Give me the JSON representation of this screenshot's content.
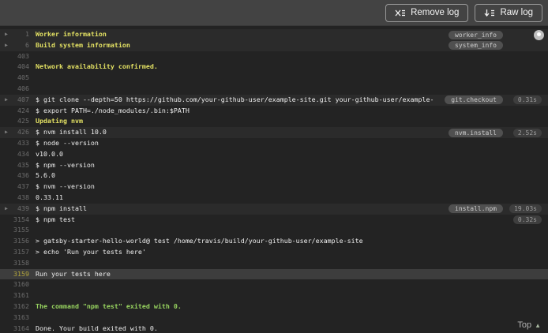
{
  "toolbar": {
    "remove_log_label": "Remove log",
    "raw_log_label": "Raw log"
  },
  "footer": {
    "top_label": "Top"
  },
  "colors": {
    "topbar_bg": "#434343",
    "log_bg": "#232323",
    "fold_row_bg": "#2b2b2b",
    "highlight_row_bg": "#3d3d3d",
    "ansi_yellow": "#e3e163",
    "ansi_green": "#97d35f",
    "log_text": "#efefef",
    "line_number": "#6d6d6d",
    "highlight_line_number": "#b3a53c"
  },
  "log": {
    "rows": [
      {
        "num": "1",
        "text": "Worker information",
        "style": "yellow",
        "fold": true,
        "fold_bg": true,
        "badge": "worker_info",
        "scroll_knob": true
      },
      {
        "num": "6",
        "text": "Build system information",
        "style": "yellow",
        "fold": true,
        "fold_bg": true,
        "badge": "system_info"
      },
      {
        "num": "403",
        "text": ""
      },
      {
        "num": "404",
        "text": "Network availability confirmed.",
        "style": "yellow"
      },
      {
        "num": "405",
        "text": ""
      },
      {
        "num": "406",
        "text": ""
      },
      {
        "num": "407",
        "text": "$ git clone --depth=50 https://github.com/your-github-user/example-site.git your-github-user/example-",
        "fold": true,
        "fold_bg": true,
        "badge": "git.checkout",
        "duration": "0.31s"
      },
      {
        "num": "424",
        "text": "$ export PATH=./node_modules/.bin:$PATH"
      },
      {
        "num": "425",
        "text": "Updating nvm",
        "style": "yellow"
      },
      {
        "num": "426",
        "text": "$ nvm install 10.0",
        "fold": true,
        "fold_bg": true,
        "badge": "nvm.install",
        "duration": "2.52s"
      },
      {
        "num": "433",
        "text": "$ node --version"
      },
      {
        "num": "434",
        "text": "v10.0.0"
      },
      {
        "num": "435",
        "text": "$ npm --version"
      },
      {
        "num": "436",
        "text": "5.6.0"
      },
      {
        "num": "437",
        "text": "$ nvm --version"
      },
      {
        "num": "438",
        "text": "0.33.11"
      },
      {
        "num": "439",
        "text": "$ npm install",
        "fold": true,
        "fold_bg": true,
        "badge": "install.npm",
        "duration": "19.03s"
      },
      {
        "num": "3154",
        "text": "$ npm test",
        "duration": "0.32s"
      },
      {
        "num": "3155",
        "text": ""
      },
      {
        "num": "3156",
        "text": "> gatsby-starter-hello-world@ test /home/travis/build/your-github-user/example-site"
      },
      {
        "num": "3157",
        "text": "> echo 'Run your tests here'"
      },
      {
        "num": "3158",
        "text": ""
      },
      {
        "num": "3159",
        "text": "Run your tests here",
        "highlight": true
      },
      {
        "num": "3160",
        "text": ""
      },
      {
        "num": "3161",
        "text": ""
      },
      {
        "num": "3162",
        "text": "The command \"npm test\" exited with 0.",
        "style": "green"
      },
      {
        "num": "3163",
        "text": ""
      },
      {
        "num": "3164",
        "text": "Done. Your build exited with 0."
      }
    ]
  }
}
